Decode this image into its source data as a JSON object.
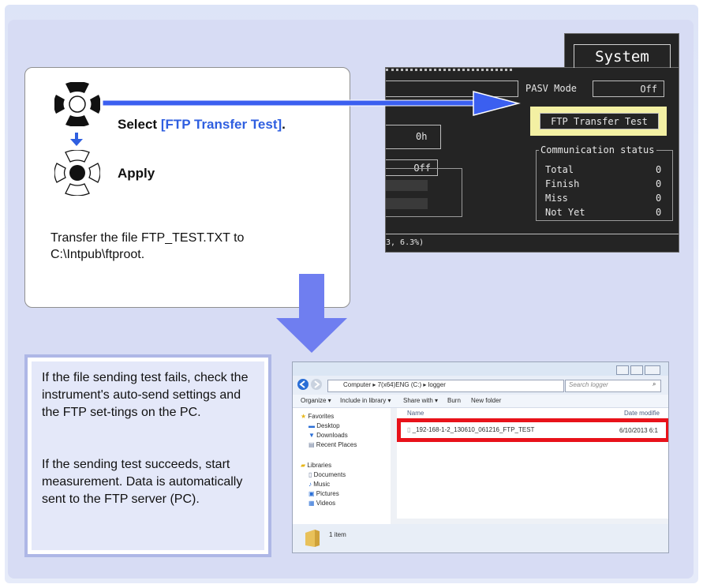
{
  "instruction": {
    "select_prefix": "Select ",
    "select_highlight": "[FTP Transfer Test]",
    "select_suffix": ".",
    "apply_label": "Apply",
    "note": "Transfer the file FTP_TEST.TXT to\nC:\\Intpub\\ftproot."
  },
  "screen": {
    "system_button": "System",
    "pasv_label": "PASV Mode",
    "pasv_value": "Off",
    "ftp_test_button": "FTP Transfer Test",
    "hours_value": "0h",
    "off_value": "Off",
    "comm_title": "Communication status",
    "stats": [
      {
        "label": "Total",
        "value": "0"
      },
      {
        "label": "Finish",
        "value": "0"
      },
      {
        "label": "Miss",
        "value": "0"
      },
      {
        "label": "Not Yet",
        "value": "0"
      }
    ],
    "footer_text": "3, 6.3%)"
  },
  "info": {
    "fail_text": "If the file sending test fails, check the instrument's auto-send settings and the FTP set-tings on the PC.",
    "success_text": "If the sending test succeeds, start measurement. Data is automatically sent to the FTP server (PC)."
  },
  "explorer": {
    "path_parts": [
      "Computer",
      "7(x64)ENG (C:)",
      "logger"
    ],
    "search_placeholder": "Search logger",
    "toolbar": [
      "Organize ▾",
      "Include in library ▾",
      "Share with ▾",
      "Burn",
      "New folder"
    ],
    "col_name": "Name",
    "col_date": "Date modifie",
    "nav": {
      "favorites": "Favorites",
      "favorites_items": [
        "Desktop",
        "Downloads",
        "Recent Places"
      ],
      "libraries": "Libraries",
      "libraries_items": [
        "Documents",
        "Music",
        "Pictures",
        "Videos"
      ]
    },
    "file_name": "_192-168-1-2_130610_061216_FTP_TEST",
    "file_date": "6/10/2013 6:1",
    "status": "1 item"
  },
  "colors": {
    "highlight_text": "#2f5fe0",
    "arrow": "#3b5ff0",
    "screen_highlight": "#f3f0a3",
    "file_highlight": "#e8121a"
  }
}
